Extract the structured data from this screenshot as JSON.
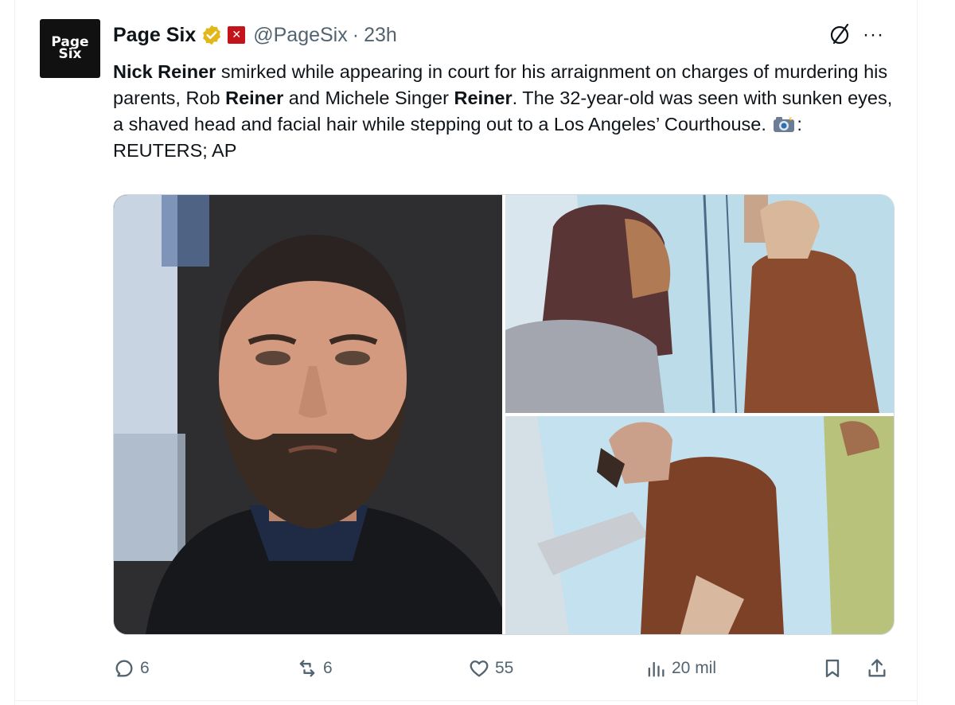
{
  "account": {
    "avatar_lines": [
      "Page",
      "Six"
    ],
    "name": "Page Six",
    "handle": "@PageSix",
    "separator": "·",
    "time": "23h"
  },
  "tweet": {
    "t1_b": "Nick Reiner",
    "t1": " smirked while appearing in court for his arraignment on charges of murdering his parents, Rob ",
    "t2_b": "Reiner",
    "t2": " and Michele Singer ",
    "t3_b": "Reiner",
    "t3": ". The 32-year-old was seen with sunken eyes, a shaved head and facial hair while stepping out to a Los Angeles’ Courthouse. ",
    "t4": ": REUTERS; AP"
  },
  "icons": {
    "verified": "verified-badge-icon",
    "flag": "affiliation-badge-icon",
    "grok": "grok-icon",
    "more": "more-icon",
    "camera": "camera-flash-emoji",
    "reply": "reply-icon",
    "retweet": "retweet-icon",
    "like": "like-icon",
    "views": "views-icon",
    "bookmark": "bookmark-icon",
    "share": "share-icon"
  },
  "colors": {
    "verified_gold": "#e2b719",
    "flag_red": "#c4141b",
    "secondary_text": "#536471"
  },
  "actions": {
    "replies": "6",
    "reposts": "6",
    "likes": "55",
    "views": "20 mil"
  }
}
